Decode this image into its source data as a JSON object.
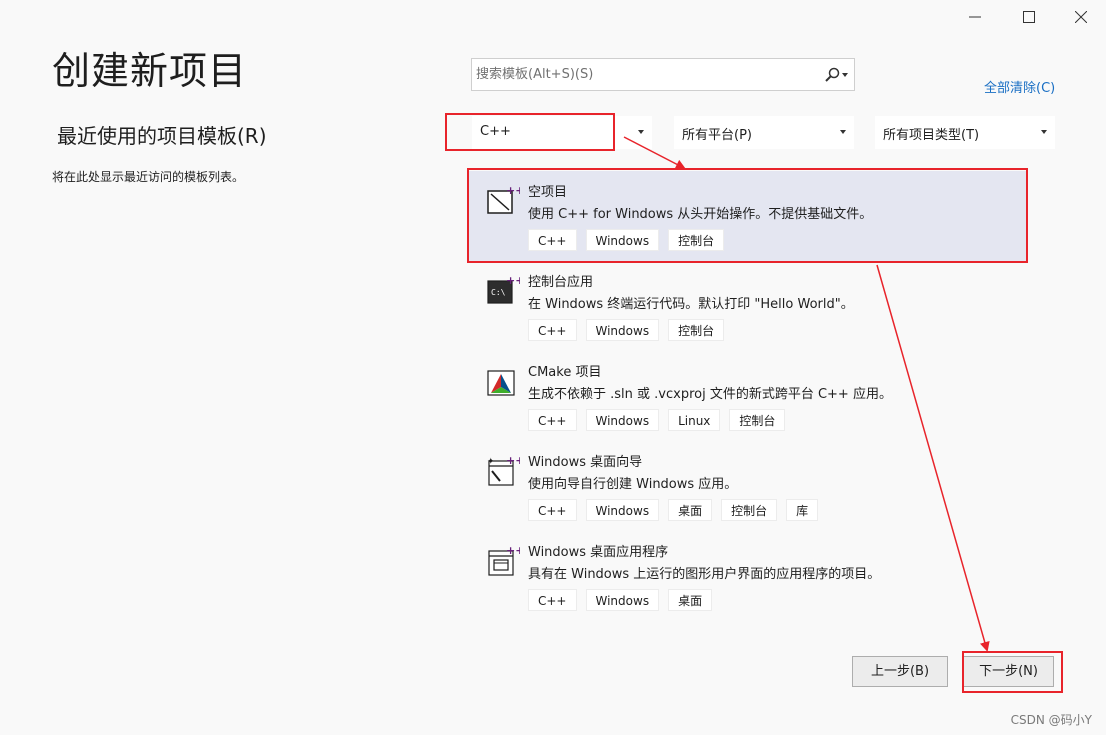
{
  "title": "创建新项目",
  "recent": {
    "title": "最近使用的项目模板(R)",
    "description": "将在此处显示最近访问的模板列表。"
  },
  "search": {
    "placeholder": "搜索模板(Alt+S)(S)"
  },
  "clear_all": "全部清除(C)",
  "filters": {
    "language": "C++",
    "platform": "所有平台(P)",
    "project_type": "所有项目类型(T)"
  },
  "templates": [
    {
      "title": "空项目",
      "icon": "empty-project-icon",
      "description": "使用 C++ for Windows 从头开始操作。不提供基础文件。",
      "tags": [
        "C++",
        "Windows",
        "控制台"
      ],
      "selected": true
    },
    {
      "title": "控制台应用",
      "icon": "console-app-icon",
      "description": "在 Windows 终端运行代码。默认打印 \"Hello World\"。",
      "tags": [
        "C++",
        "Windows",
        "控制台"
      ]
    },
    {
      "title": "CMake 项目",
      "icon": "cmake-icon",
      "description": "生成不依赖于 .sln 或 .vcxproj 文件的新式跨平台 C++ 应用。",
      "tags": [
        "C++",
        "Windows",
        "Linux",
        "控制台"
      ]
    },
    {
      "title": "Windows 桌面向导",
      "icon": "desktop-wizard-icon",
      "description": "使用向导自行创建 Windows 应用。",
      "tags": [
        "C++",
        "Windows",
        "桌面",
        "控制台",
        "库"
      ]
    },
    {
      "title": "Windows 桌面应用程序",
      "icon": "desktop-app-icon",
      "description": "具有在 Windows 上运行的图形用户界面的应用程序的项目。",
      "tags": [
        "C++",
        "Windows",
        "桌面"
      ]
    }
  ],
  "buttons": {
    "back": "上一步(B)",
    "next": "下一步(N)"
  },
  "watermark": "CSDN @码小Y",
  "colors": {
    "highlight": "#e8242b",
    "selected_bg": "#e4e6f1",
    "link": "#1a6fc4",
    "cpp_badge": "#68217a"
  }
}
